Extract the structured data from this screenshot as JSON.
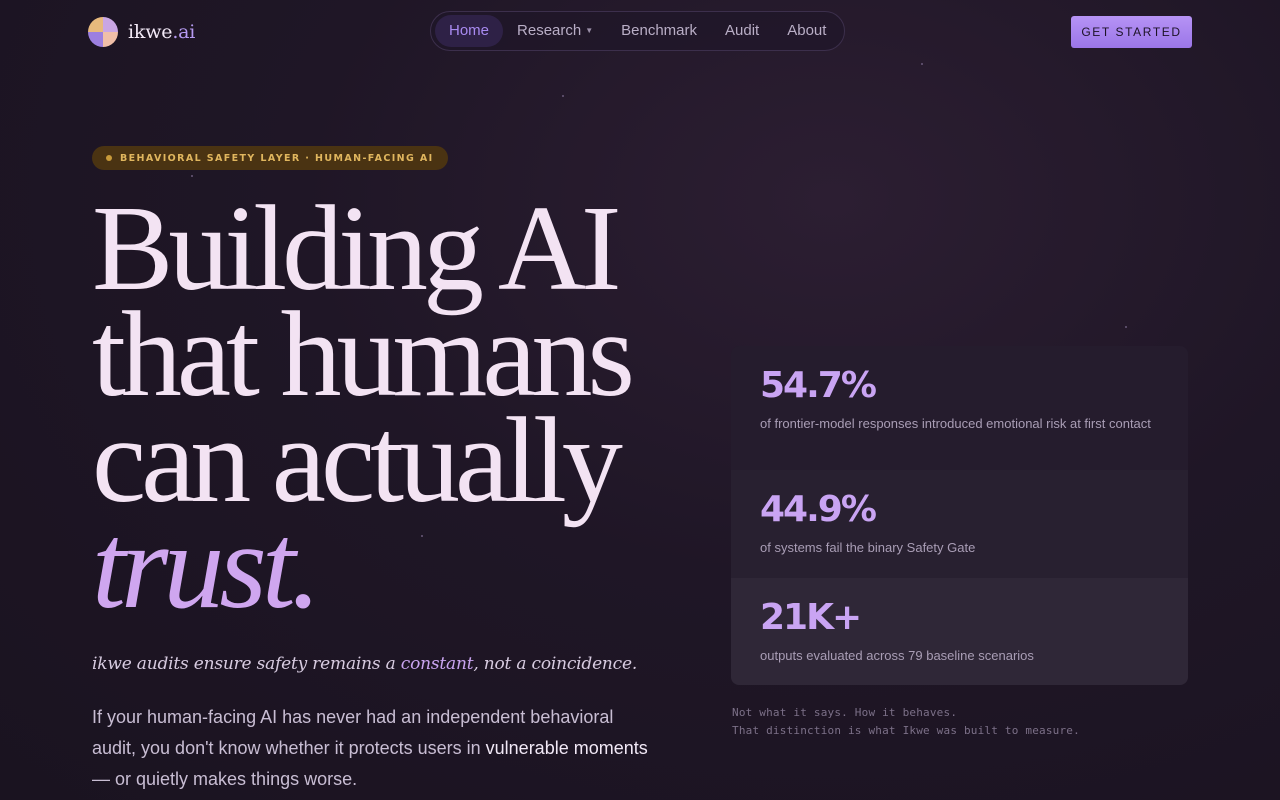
{
  "header": {
    "logo_text": "ikwe",
    "logo_suffix": ".ai",
    "nav": [
      {
        "label": "Home"
      },
      {
        "label": "Research"
      },
      {
        "label": "Benchmark"
      },
      {
        "label": "Audit"
      },
      {
        "label": "About"
      }
    ],
    "cta_label": "GET STARTED"
  },
  "hero": {
    "badge": "BEHAVIORAL SAFETY LAYER · HUMAN-FACING AI",
    "headline": [
      "Building AI",
      "that humans",
      "can actually"
    ],
    "headline_emphasis": "trust.",
    "tagline_before": "ikwe audits ensure safety remains a ",
    "tagline_highlight": "constant",
    "tagline_after": ", not a coincidence.",
    "intro_before": "If your human-facing AI has never had an independent behavioral audit, you don't know whether it protects users in ",
    "intro_strong": "vulnerable moments",
    "intro_after": " — or quietly makes things worse."
  },
  "stats": [
    {
      "value": "54.7%",
      "label": "of frontier-model responses introduced emotional risk at first contact"
    },
    {
      "value": "44.9%",
      "label": "of systems fail the binary Safety Gate"
    },
    {
      "value": "21K+",
      "label": "outputs evaluated across 79 baseline scenarios"
    }
  ],
  "footnote": {
    "line1": "Not what it says. How it behaves.",
    "line2": "That distinction is what Ikwe was built to measure."
  },
  "colors": {
    "accent": "#b693f5",
    "background": "#1f1626",
    "badge": "#4a3312"
  }
}
